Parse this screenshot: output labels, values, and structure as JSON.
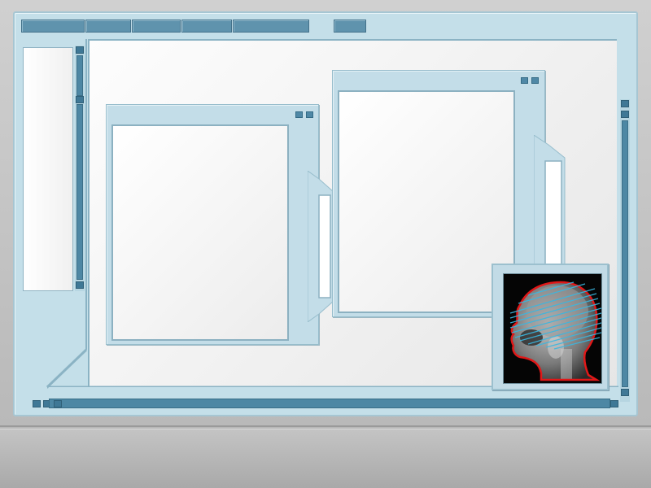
{
  "app": {
    "tabs": [
      {
        "id": "tab-1"
      },
      {
        "id": "tab-2"
      },
      {
        "id": "tab-3"
      },
      {
        "id": "tab-4"
      },
      {
        "id": "tab-5"
      },
      {
        "id": "tab-6"
      }
    ]
  },
  "thumbnail": {
    "icon": "xray-head-scan-icon",
    "outline_color": "#e01818",
    "scanline_color": "#3ab7e0"
  },
  "colors": {
    "frame": "#c4dfe9",
    "accent": "#5f93ad",
    "panel": "#ffffff"
  }
}
